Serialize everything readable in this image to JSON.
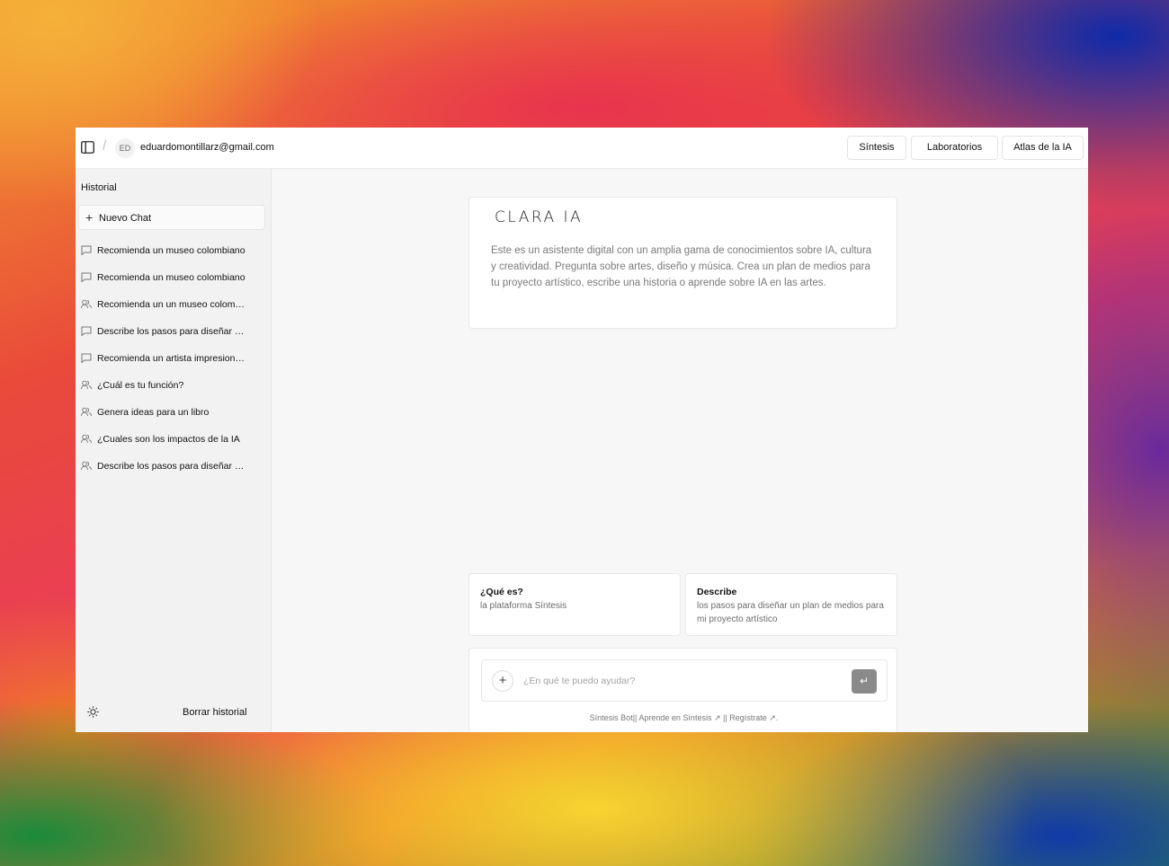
{
  "header": {
    "avatar_initials": "ED",
    "email": "eduardomontillarz@gmail.com",
    "nav": [
      "Síntesis",
      "Laboratorios",
      "Atlas de la IA"
    ]
  },
  "sidebar": {
    "title": "Historial",
    "new_chat": "Nuevo Chat",
    "items": [
      {
        "label": "Recomienda un museo colombiano",
        "icon": "chat-bubble-icon"
      },
      {
        "label": "Recomienda un museo colombiano",
        "icon": "chat-bubble-icon"
      },
      {
        "label": "Recomienda un un museo colombiano",
        "icon": "users-icon"
      },
      {
        "label": "Describe los pasos para diseñar un plan de medios",
        "icon": "chat-bubble-icon"
      },
      {
        "label": "Recomienda un artista impresionista",
        "icon": "chat-bubble-icon"
      },
      {
        "label": "¿Cuál es tu función?",
        "icon": "users-icon"
      },
      {
        "label": "Genera ideas para un libro",
        "icon": "users-icon"
      },
      {
        "label": "¿Cuales son los impactos de la IA",
        "icon": "users-icon"
      },
      {
        "label": "Describe los pasos para diseñar un plan",
        "icon": "users-icon"
      }
    ],
    "clear_history": "Borrar historial",
    "theme_icon": "sun-icon"
  },
  "intro": {
    "logo": "CLARA IA",
    "description": "Este es un asistente digital con un amplia gama de conocimientos sobre IA, cultura y creatividad. Pregunta sobre artes, diseño y música. Crea un plan de medios para tu proyecto artístico, escribe una historia o aprende sobre IA en las artes."
  },
  "suggestions": [
    {
      "title": "¿Qué es?",
      "description": "la plataforma Síntesis"
    },
    {
      "title": "Describe",
      "description": "los pasos para diseñar un plan de medios para mi proyecto artístico"
    }
  ],
  "composer": {
    "placeholder": "¿En qué te puedo ayudar?",
    "value": "",
    "send_icon": "enter-icon",
    "attach_icon": "plus-icon"
  },
  "footer": {
    "bot": "Síntesis Bot",
    "sep1": "|| ",
    "learn": "Aprende en Síntesis",
    "sep2": " || ",
    "register": "Regístrate",
    "end": "."
  }
}
